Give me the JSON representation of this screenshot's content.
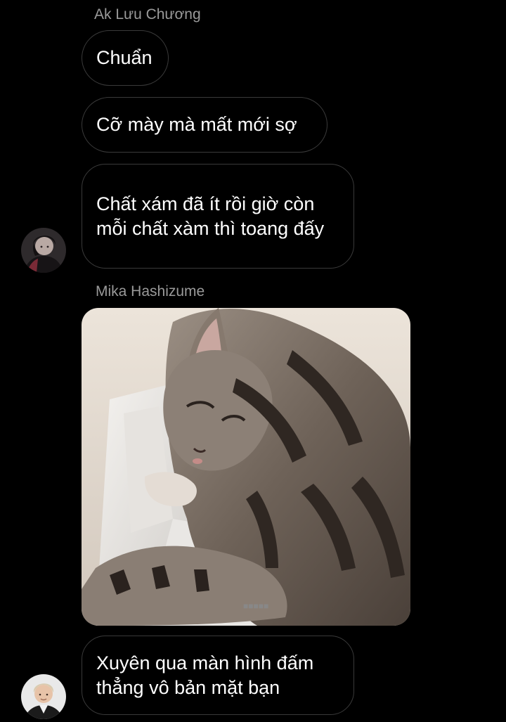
{
  "thread": {
    "group1": {
      "sender": "Ak Lưu Chương",
      "messages": [
        "Chuẩn",
        "Cỡ mày mà mất mới sợ",
        "Chất xám đã ít rồi giờ còn mỗi chất xàm thì toang đấy"
      ],
      "avatar_icon": "user-avatar-dark"
    },
    "group2": {
      "sender": "Mika Hashizume",
      "image_icon": "tabby-cat-photo",
      "message": "Xuyên qua màn hình đấm thẳng vô bản mặt bạn",
      "avatar_icon": "user-avatar-light"
    }
  },
  "colors": {
    "background": "#000000",
    "bubble_border": "#3a3a3a",
    "sender_text": "#9a9a9a",
    "message_text": "#ffffff"
  }
}
